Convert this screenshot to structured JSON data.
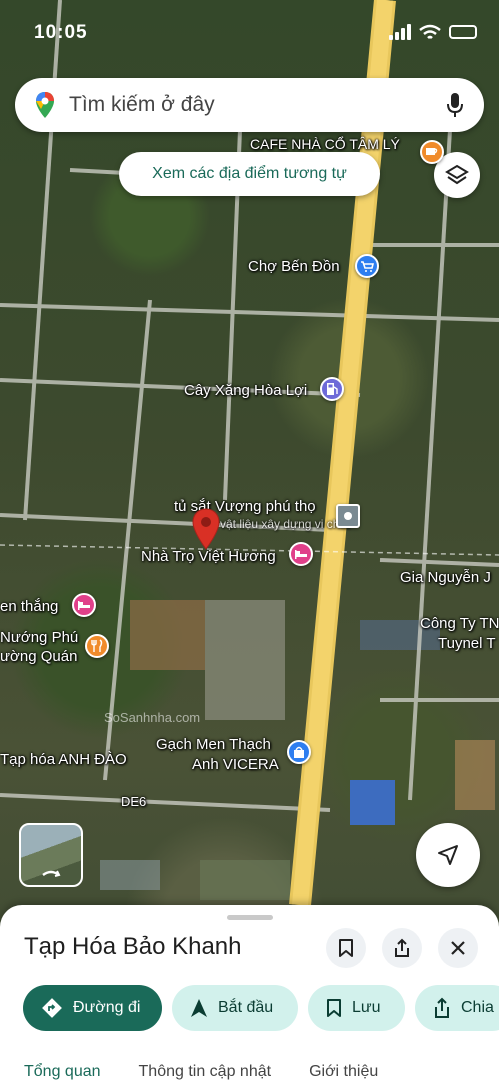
{
  "status_bar": {
    "time": "10:05"
  },
  "search": {
    "placeholder": "Tìm kiếm ở đây"
  },
  "chip": {
    "label": "Xem các địa điểm tương tự"
  },
  "map_labels": {
    "cafe": "CAFE NHÀ CỔ TÂM LÝ",
    "cho": "Chợ Bến Đồn",
    "cayxang": "Cây Xăng Hòa Lợi",
    "tusat": "tủ sắt Vượng phú thọ",
    "vatlieu": "vật liệu xây dựng vi chất",
    "nhatro": "Nhà Trọ Việt Hương",
    "gia": "Gia Nguyễn J",
    "congty": "Công Ty TN",
    "tuynel": "Tuynel T",
    "enthang": "en thắng",
    "nuong1": "Nướng Phú",
    "nuong2": "ường Quán",
    "taphoa": "Tạp hóa ANH ĐÀO",
    "gach1": "Gạch Men Thạch",
    "gach2": "Anh VICERA",
    "de6": "DE6",
    "watermark": "SoSanhnha.com"
  },
  "place": {
    "title": "Tạp Hóa Bảo Khanh"
  },
  "actions": {
    "directions": "Đường đi",
    "start": "Bắt đầu",
    "save": "Lưu",
    "share": "Chia"
  },
  "tabs": [
    "Tổng quan",
    "Thông tin cập nhật",
    "Giới thiệu"
  ],
  "colors": {
    "accent": "#1a6a59",
    "chip_bg": "#d2f1ec",
    "pin": "#d93025",
    "road": "#f3d36b"
  }
}
